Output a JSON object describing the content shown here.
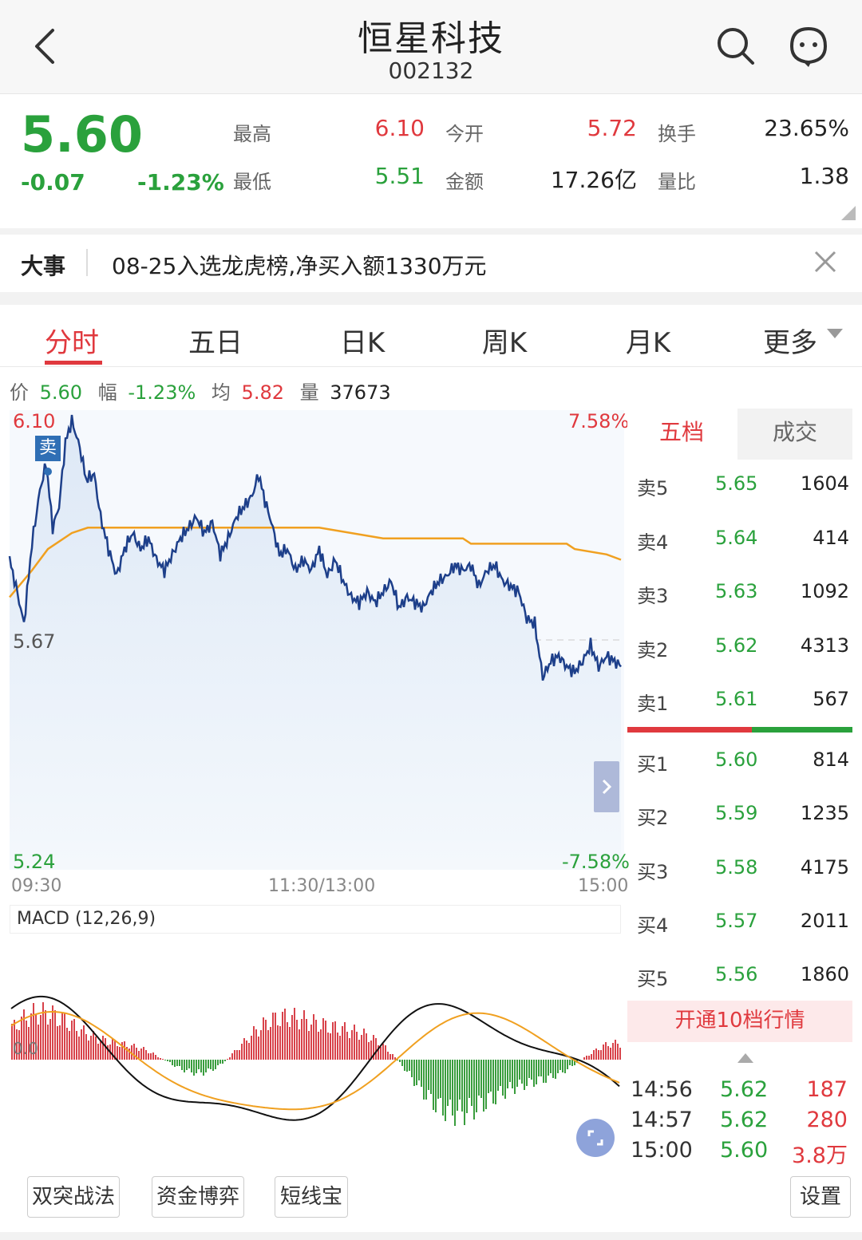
{
  "header": {
    "title": "恒星科技",
    "code": "002132"
  },
  "quote": {
    "price": "5.60",
    "change": "-0.07",
    "change_pct": "-1.23%",
    "high_label": "最高",
    "high": "6.10",
    "low_label": "最低",
    "low": "5.51",
    "open_label": "今开",
    "open": "5.72",
    "amount_label": "金额",
    "amount": "17.26亿",
    "turnover_label": "换手",
    "turnover": "23.65%",
    "vol_ratio_label": "量比",
    "vol_ratio": "1.38"
  },
  "news": {
    "label": "大事",
    "text": "08-25入选龙虎榜,净买入额1330万元"
  },
  "tabs": [
    "分时",
    "五日",
    "日K",
    "周K",
    "月K",
    "更多"
  ],
  "info": {
    "price_label": "价",
    "price": "5.60",
    "range_label": "幅",
    "range": "-1.23%",
    "avg_label": "均",
    "avg": "5.82",
    "vol_label": "量",
    "vol": "37673"
  },
  "chart": {
    "y_max": "6.10",
    "y_mid": "5.67",
    "y_min": "5.24",
    "pct_max": "7.58%",
    "pct_min": "-7.58%",
    "x_start": "09:30",
    "x_mid": "11:30/13:00",
    "x_end": "15:00",
    "sell_tag": "卖",
    "macd_label": "MACD (12,26,9)",
    "macd_zero": "0.0"
  },
  "chart_data": {
    "type": "line",
    "ylim": [
      5.24,
      6.1
    ],
    "x": [
      "09:30",
      "11:30/13:00",
      "15:00"
    ],
    "series": [],
    "grid": true
  },
  "book": {
    "tab_five": "五档",
    "tab_deal": "成交",
    "sells": [
      {
        "name": "卖5",
        "price": "5.65",
        "vol": "1604"
      },
      {
        "name": "卖4",
        "price": "5.64",
        "vol": "414"
      },
      {
        "name": "卖3",
        "price": "5.63",
        "vol": "1092"
      },
      {
        "name": "卖2",
        "price": "5.62",
        "vol": "4313"
      },
      {
        "name": "卖1",
        "price": "5.61",
        "vol": "567"
      }
    ],
    "buys": [
      {
        "name": "买1",
        "price": "5.60",
        "vol": "814"
      },
      {
        "name": "买2",
        "price": "5.59",
        "vol": "1235"
      },
      {
        "name": "买3",
        "price": "5.58",
        "vol": "4175"
      },
      {
        "name": "买4",
        "price": "5.57",
        "vol": "2011"
      },
      {
        "name": "买5",
        "price": "5.56",
        "vol": "1860"
      }
    ],
    "open10": "开通10档行情"
  },
  "trades": [
    {
      "time": "14:56",
      "price": "5.62",
      "vol": "187"
    },
    {
      "time": "14:57",
      "price": "5.62",
      "vol": "280"
    },
    {
      "time": "15:00",
      "price": "5.60",
      "vol": "3.8万"
    }
  ],
  "bottom_buttons": [
    "双突战法",
    "资金博弈",
    "短线宝",
    "设置"
  ],
  "colors": {
    "up": "#e0393e",
    "down": "#2aa13c",
    "line": "#1d3f8a",
    "avg": "#f0a020"
  }
}
